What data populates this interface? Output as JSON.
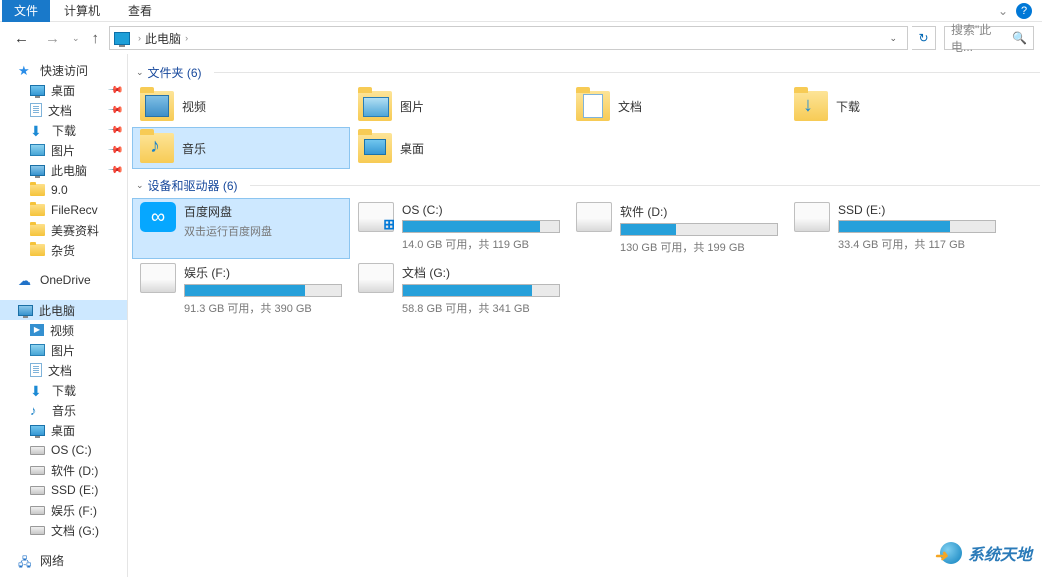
{
  "menubar": {
    "file": "文件",
    "computer": "计算机",
    "view": "查看"
  },
  "nav": {
    "location": "此电脑",
    "search_placeholder": "搜索\"此电...",
    "refresh_symbol": "↻"
  },
  "sidebar": {
    "quick": {
      "label": "快速访问",
      "items": [
        {
          "label": "桌面",
          "pinned": true
        },
        {
          "label": "文档",
          "pinned": true
        },
        {
          "label": "下载",
          "pinned": true
        },
        {
          "label": "图片",
          "pinned": true
        },
        {
          "label": "此电脑",
          "pinned": true
        },
        {
          "label": "9.0"
        },
        {
          "label": "FileRecv"
        },
        {
          "label": "美赛资料"
        },
        {
          "label": "杂货"
        }
      ]
    },
    "onedrive": "OneDrive",
    "thispc": {
      "label": "此电脑",
      "items": [
        {
          "label": "视频"
        },
        {
          "label": "图片"
        },
        {
          "label": "文档"
        },
        {
          "label": "下载"
        },
        {
          "label": "音乐"
        },
        {
          "label": "桌面"
        },
        {
          "label": "OS (C:)"
        },
        {
          "label": "软件 (D:)"
        },
        {
          "label": "SSD (E:)"
        },
        {
          "label": "娱乐 (F:)"
        },
        {
          "label": "文档 (G:)"
        }
      ]
    },
    "network": "网络"
  },
  "content": {
    "folders_header": "文件夹 (6)",
    "folders": [
      {
        "label": "视频"
      },
      {
        "label": "图片"
      },
      {
        "label": "文档"
      },
      {
        "label": "下载"
      },
      {
        "label": "音乐",
        "selected": true
      },
      {
        "label": "桌面"
      }
    ],
    "drives_header": "设备和驱动器 (6)",
    "baidu": {
      "label": "百度网盘",
      "sub": "双击运行百度网盘"
    },
    "drives": [
      {
        "label": "OS (C:)",
        "sub": "14.0 GB 可用，共 119 GB",
        "fill": 88,
        "win": true
      },
      {
        "label": "软件 (D:)",
        "sub": "130 GB 可用，共 199 GB",
        "fill": 35
      },
      {
        "label": "SSD (E:)",
        "sub": "33.4 GB 可用，共 117 GB",
        "fill": 71
      },
      {
        "label": "娱乐 (F:)",
        "sub": "91.3 GB 可用，共 390 GB",
        "fill": 77
      },
      {
        "label": "文档 (G:)",
        "sub": "58.8 GB 可用，共 341 GB",
        "fill": 83
      }
    ]
  },
  "watermark": "系统天地"
}
